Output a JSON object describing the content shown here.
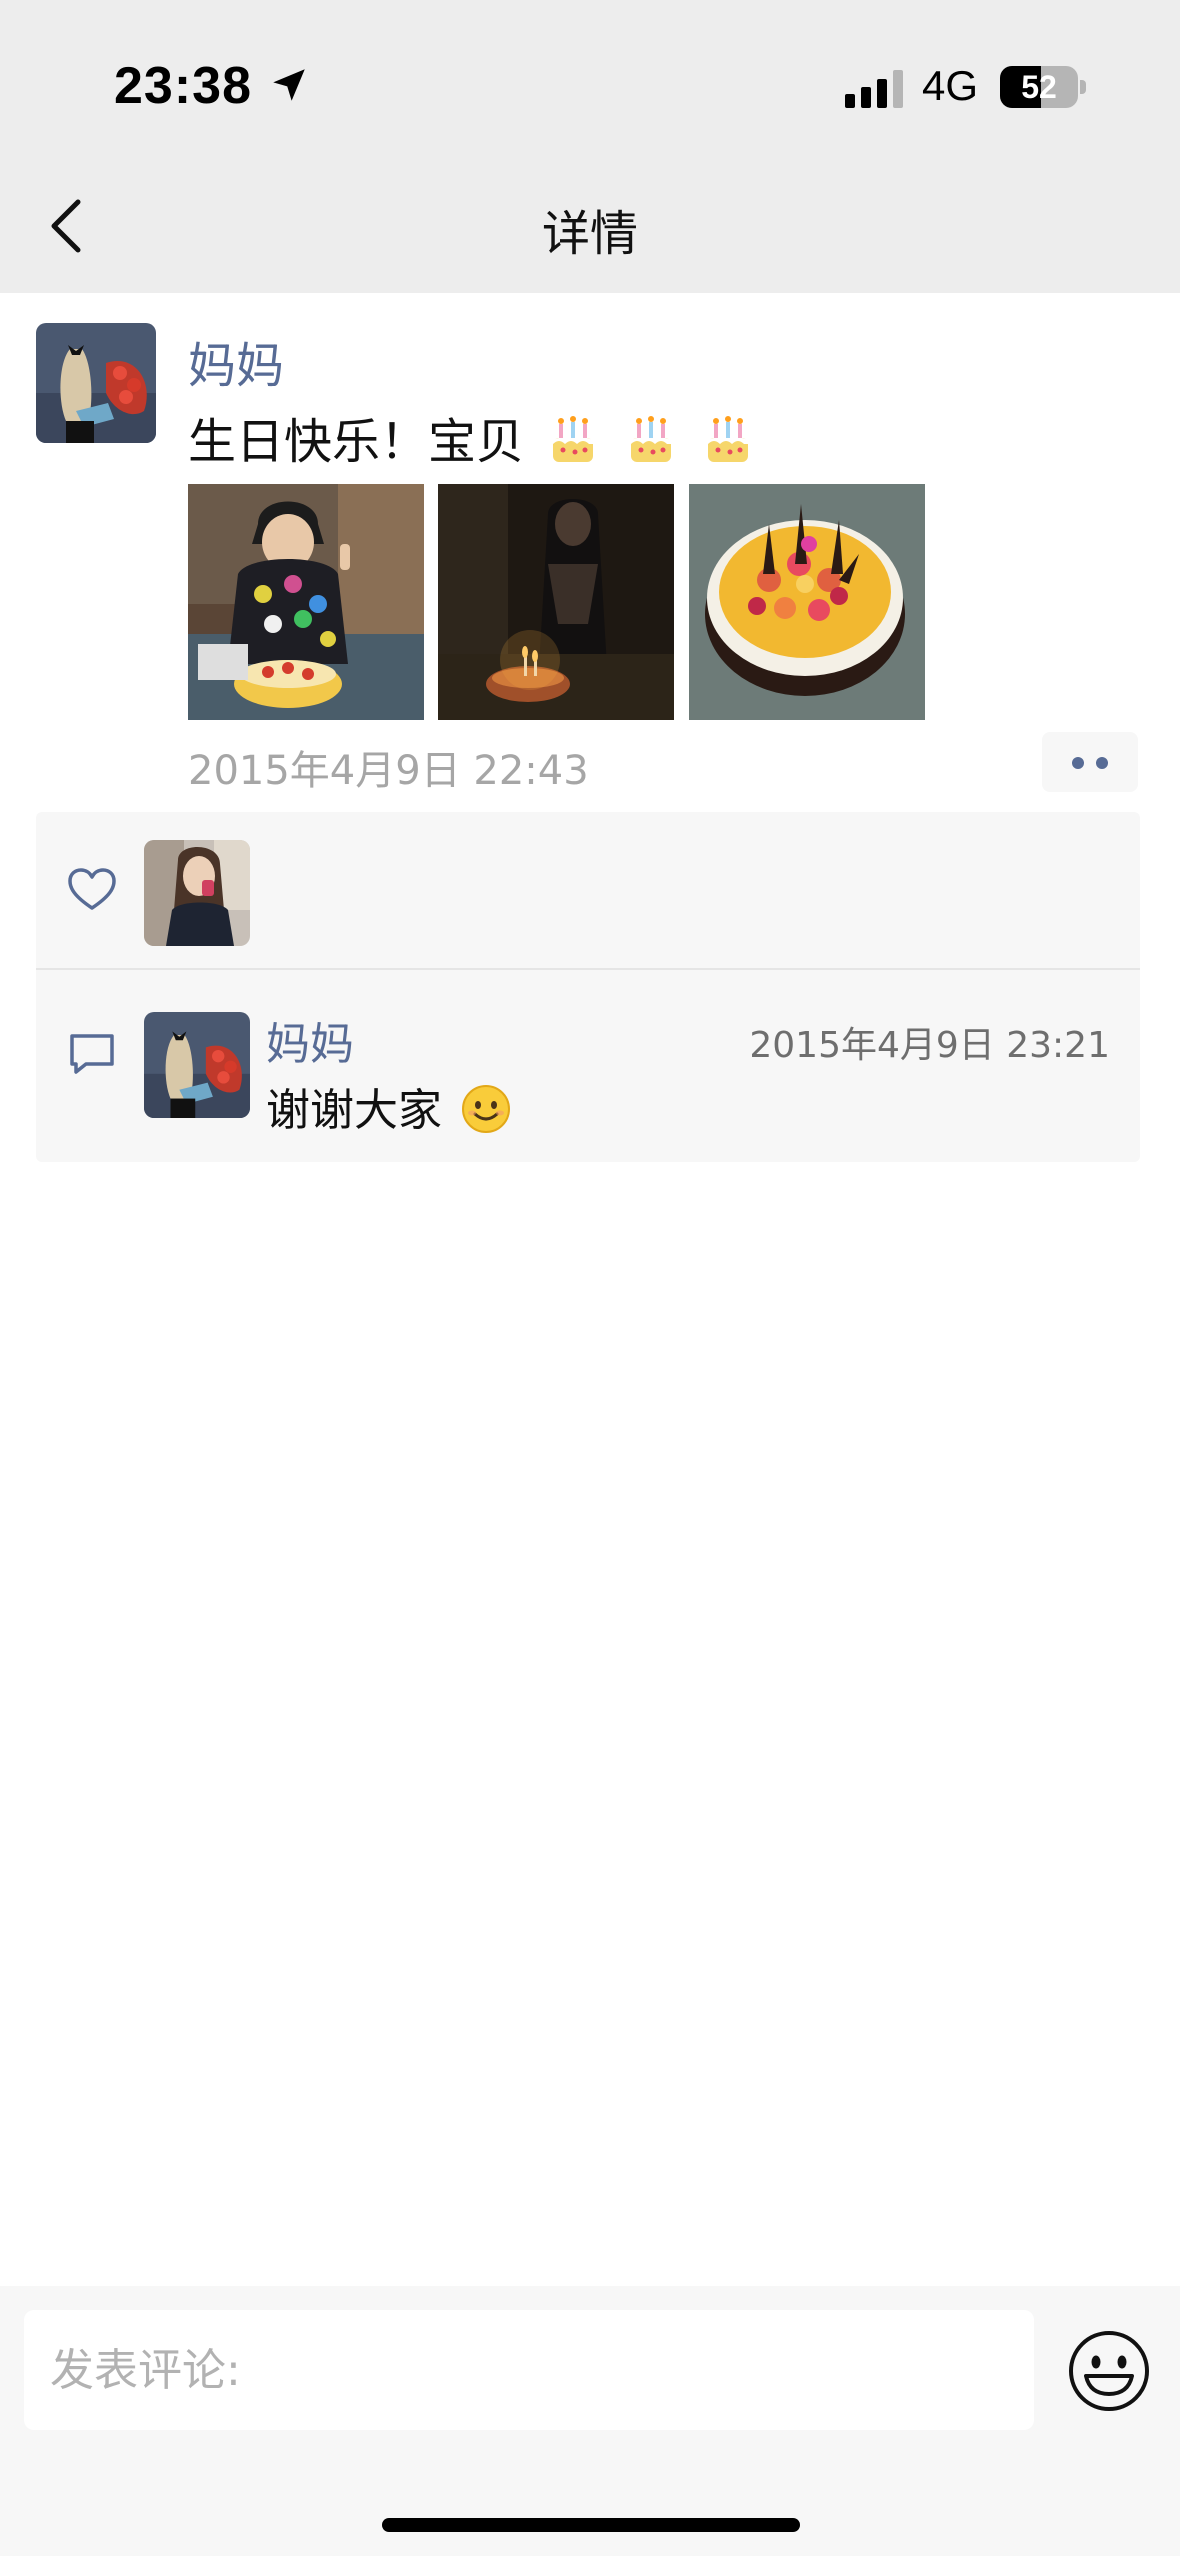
{
  "status_bar": {
    "time": "23:38",
    "network": "4G",
    "battery": "52",
    "battery_level": 0.52,
    "location_icon": "location-arrow-icon",
    "signal_icon": "signal-bars-icon"
  },
  "nav": {
    "title": "详情",
    "back_icon": "chevron-left-icon"
  },
  "post": {
    "author": "妈妈",
    "text": "生日快乐！宝贝",
    "emoji_icons": [
      "birthday-cake-icon",
      "birthday-cake-icon",
      "birthday-cake-icon"
    ],
    "photos": [
      "birthday-child-photo",
      "candle-lit-cake-photo",
      "fruit-cake-photo"
    ],
    "time": "2015年4月9日 22:43",
    "more_icon": "more-dots-icon"
  },
  "likes": {
    "icon": "heart-icon",
    "count": 1
  },
  "comments": [
    {
      "author": "妈妈",
      "time": "2015年4月9日 23:21",
      "text": "谢谢大家",
      "emoji_icon": "smile-emoji-icon"
    }
  ],
  "composer": {
    "placeholder": "发表评论:",
    "emoji_icon": "smiley-face-icon"
  },
  "colors": {
    "link_blue": "#576b95",
    "nav_bg": "#ededed",
    "panel_bg": "#f7f7f7",
    "meta_gray": "#a6a6a6"
  }
}
